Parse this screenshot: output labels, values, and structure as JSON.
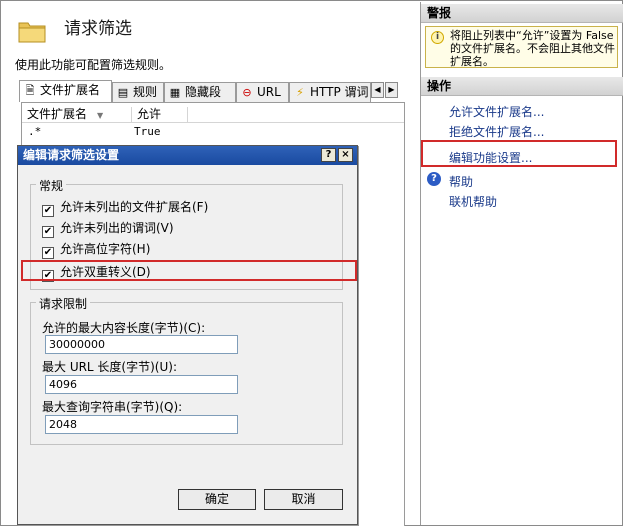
{
  "feature": {
    "title": "请求筛选",
    "description": "使用此功能可配置筛选规则。"
  },
  "tabs": [
    {
      "label": "文件扩展名",
      "icon": "document-icon"
    },
    {
      "label": "规则",
      "icon": "rules-icon"
    },
    {
      "label": "隐藏段",
      "icon": "hidden-segments-icon"
    },
    {
      "label": "URL",
      "icon": "url-icon"
    },
    {
      "label": "HTTP 谓词",
      "icon": "http-verb-icon"
    }
  ],
  "grid": {
    "columns": [
      "文件扩展名",
      "允许"
    ],
    "rows": [
      {
        "extension": ".*",
        "allowed": "True"
      }
    ]
  },
  "dialog": {
    "title": "编辑请求筛选设置",
    "help_button": "?",
    "close_button": "×",
    "general": {
      "legend": "常规",
      "checkboxes": [
        {
          "label": "允许未列出的文件扩展名(F)",
          "checked": true
        },
        {
          "label": "允许未列出的谓词(V)",
          "checked": true
        },
        {
          "label": "允许高位字符(H)",
          "checked": true
        },
        {
          "label": "允许双重转义(D)",
          "checked": true
        }
      ]
    },
    "limits": {
      "legend": "请求限制",
      "fields": [
        {
          "label": "允许的最大内容长度(字节)(C):",
          "value": "30000000"
        },
        {
          "label": "最大 URL 长度(字节)(U):",
          "value": "4096"
        },
        {
          "label": "最大查询字符串(字节)(Q):",
          "value": "2048"
        }
      ]
    },
    "ok_label": "确定",
    "cancel_label": "取消"
  },
  "alerts": {
    "header": "警报",
    "message": "将阻止列表中“允许”设置为 False 的文件扩展名。不会阻止其他文件扩展名。"
  },
  "actions": {
    "header": "操作",
    "items": [
      "允许文件扩展名...",
      "拒绝文件扩展名...",
      "编辑功能设置..."
    ],
    "help": "帮助",
    "online_help": "联机帮助"
  },
  "colors": {
    "highlight": "#d12a2a",
    "dialog_title": "#1a4aa0",
    "link": "#1a3a8a"
  }
}
